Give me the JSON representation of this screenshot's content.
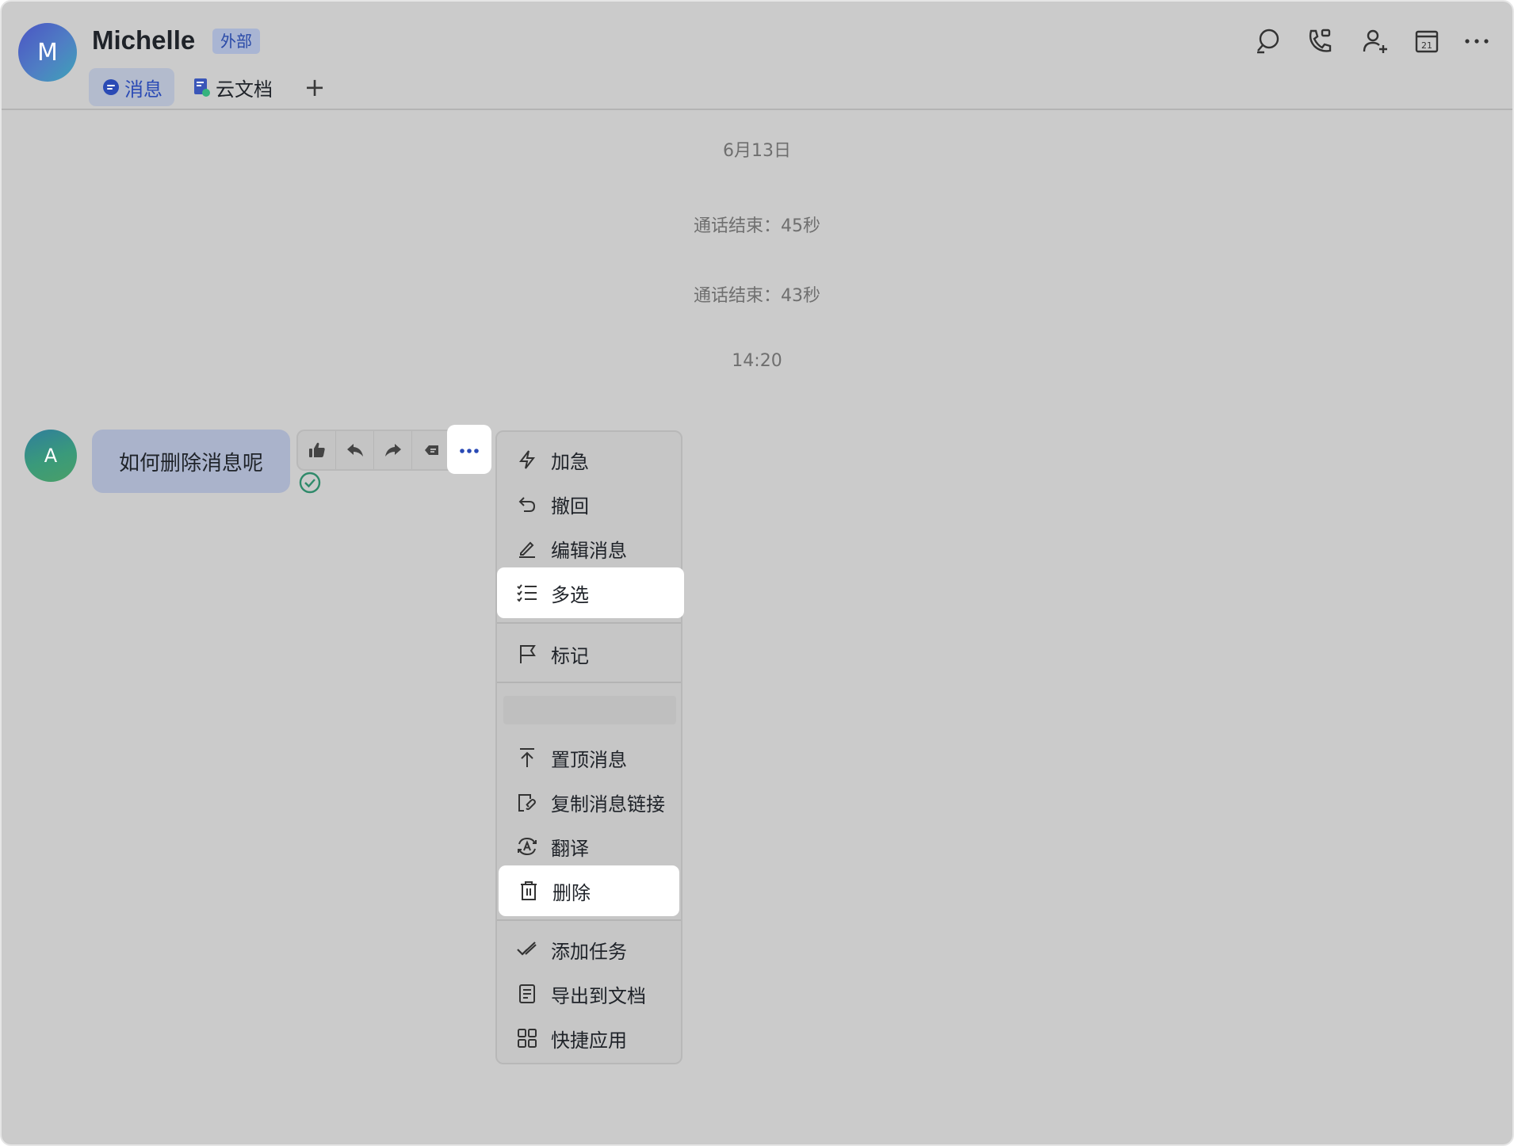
{
  "header": {
    "avatar_letter": "M",
    "chat_name": "Michelle",
    "external_badge": "外部",
    "tabs": [
      {
        "label": "消息",
        "icon": "chat-bubble-icon",
        "active": true
      },
      {
        "label": "云文档",
        "icon": "cloud-doc-icon",
        "active": false
      }
    ],
    "add_tab_label": "+",
    "actions": [
      "search-icon",
      "phone-video-icon",
      "add-member-icon",
      "calendar-icon",
      "more-icon"
    ],
    "calendar_day": "21"
  },
  "messages": {
    "date_label": "6月13日",
    "system": [
      "通话结束：45秒",
      "通话结束：43秒"
    ],
    "time_label": "14:20",
    "sender_avatar_letter": "A",
    "bubble_text": "如何删除消息呢"
  },
  "message_actions": [
    "thumbs-up-icon",
    "reply-icon",
    "forward-icon",
    "quote-icon",
    "more-dots-icon"
  ],
  "context_menu": {
    "items": [
      {
        "label": "加急",
        "icon": "lightning-icon"
      },
      {
        "label": "撤回",
        "icon": "undo-icon"
      },
      {
        "label": "编辑消息",
        "icon": "pencil-icon"
      },
      {
        "label": "多选",
        "icon": "checklist-icon",
        "highlight": true
      },
      {
        "label": "标记",
        "icon": "flag-icon"
      },
      {
        "label": "置顶消息",
        "icon": "pin-top-icon"
      },
      {
        "label": "复制消息链接",
        "icon": "link-icon"
      },
      {
        "label": "翻译",
        "icon": "translate-icon"
      },
      {
        "label": "删除",
        "icon": "trash-icon",
        "highlight": true
      },
      {
        "label": "添加任务",
        "icon": "task-check-icon"
      },
      {
        "label": "导出到文档",
        "icon": "document-icon"
      },
      {
        "label": "快捷应用",
        "icon": "grid-apps-icon"
      }
    ]
  },
  "colors": {
    "background": "#cbcbcb",
    "accent": "#2a4ab5",
    "badge_bg": "#a9b5d3",
    "bubble_bg": "#aab3cb",
    "read_check": "#2f8a6a"
  }
}
